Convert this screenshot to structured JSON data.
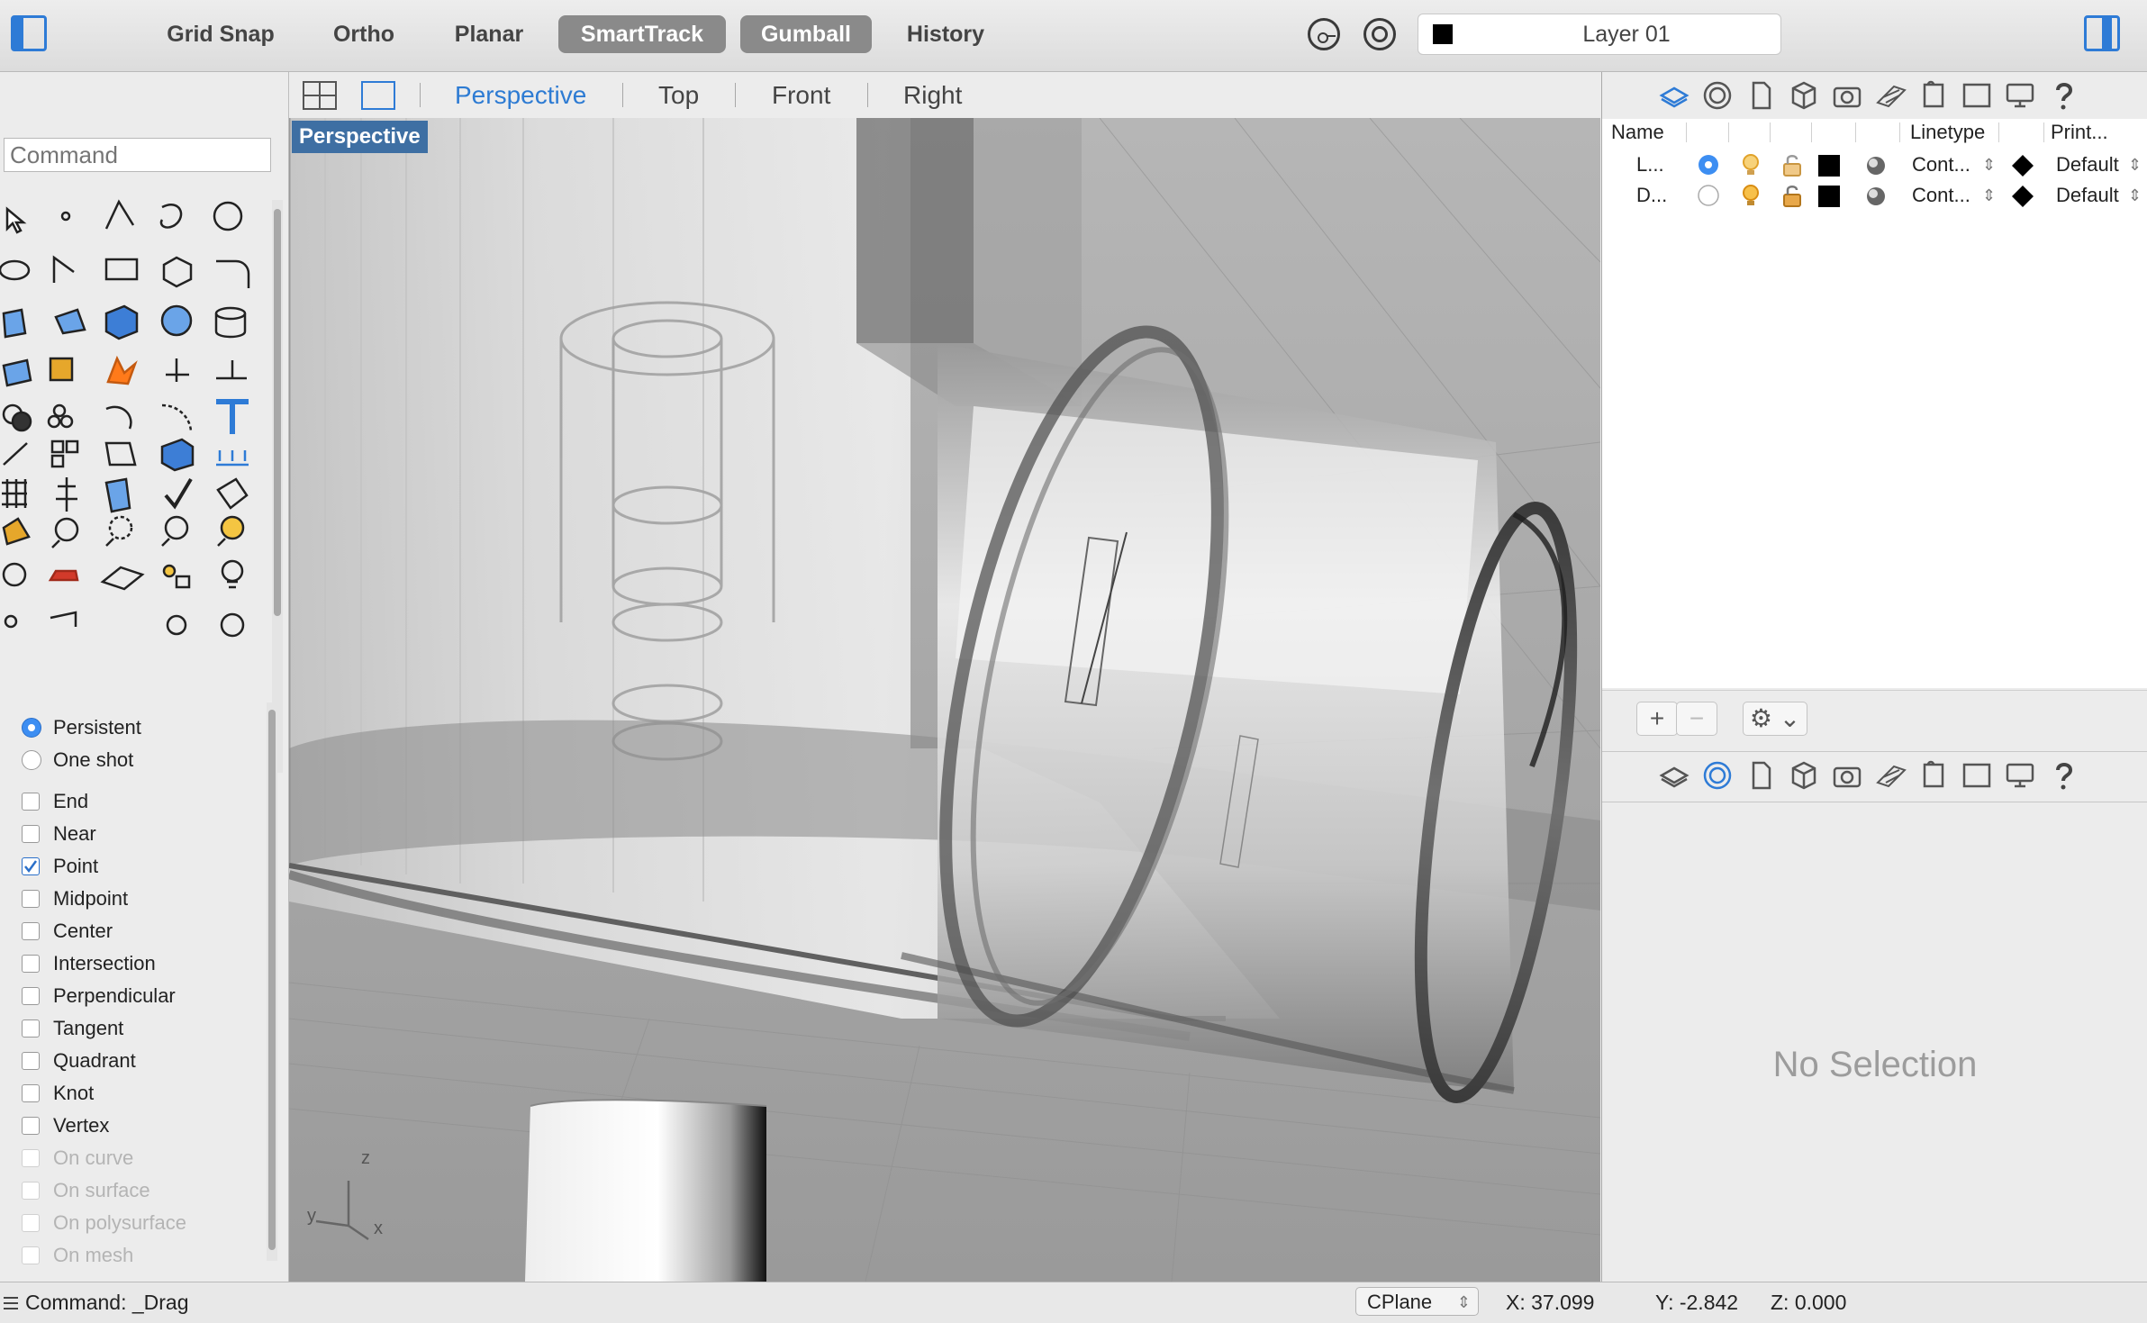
{
  "toolbar": {
    "buttons": [
      {
        "label": "Grid Snap",
        "active": false
      },
      {
        "label": "Ortho",
        "active": false
      },
      {
        "label": "Planar",
        "active": false
      },
      {
        "label": "SmartTrack",
        "active": true
      },
      {
        "label": "Gumball",
        "active": true
      },
      {
        "label": "History",
        "active": false
      }
    ],
    "current_layer": "Layer 01",
    "current_layer_color": "#000000",
    "icons": [
      "pin-icon",
      "target-icon"
    ]
  },
  "command": {
    "placeholder": "Command"
  },
  "osnap": {
    "modes": [
      {
        "label": "Persistent",
        "selected": true
      },
      {
        "label": "One shot",
        "selected": false
      }
    ],
    "items": [
      {
        "label": "End",
        "checked": false,
        "enabled": true
      },
      {
        "label": "Near",
        "checked": false,
        "enabled": true
      },
      {
        "label": "Point",
        "checked": true,
        "enabled": true
      },
      {
        "label": "Midpoint",
        "checked": false,
        "enabled": true
      },
      {
        "label": "Center",
        "checked": false,
        "enabled": true
      },
      {
        "label": "Intersection",
        "checked": false,
        "enabled": true
      },
      {
        "label": "Perpendicular",
        "checked": false,
        "enabled": true
      },
      {
        "label": "Tangent",
        "checked": false,
        "enabled": true
      },
      {
        "label": "Quadrant",
        "checked": false,
        "enabled": true
      },
      {
        "label": "Knot",
        "checked": false,
        "enabled": true
      },
      {
        "label": "Vertex",
        "checked": false,
        "enabled": true
      },
      {
        "label": "On curve",
        "checked": false,
        "enabled": false
      },
      {
        "label": "On surface",
        "checked": false,
        "enabled": false
      },
      {
        "label": "On polysurface",
        "checked": false,
        "enabled": false
      },
      {
        "label": "On mesh",
        "checked": false,
        "enabled": false
      }
    ]
  },
  "viewport": {
    "tabs": [
      "Perspective",
      "Top",
      "Front",
      "Right"
    ],
    "active_tab": "Perspective",
    "label": "Perspective",
    "axes": {
      "z": "z",
      "y": "y",
      "x": "x"
    }
  },
  "layers": {
    "columns": [
      "Name",
      "Linetype",
      "Print..."
    ],
    "rows": [
      {
        "name": "L...",
        "current": true,
        "color": "#000000",
        "linetype": "Cont...",
        "print": "Default"
      },
      {
        "name": "D...",
        "current": false,
        "color": "#000000",
        "linetype": "Cont...",
        "print": "Default"
      }
    ],
    "add_label": "+",
    "remove_label": "−"
  },
  "properties": {
    "empty_text": "No Selection"
  },
  "status": {
    "command": "Command: _Drag",
    "cplane": "CPlane",
    "x": "X: 37.099",
    "y": "Y: -2.842",
    "z": "Z: 0.000"
  },
  "accent_color": "#2e7bd6"
}
